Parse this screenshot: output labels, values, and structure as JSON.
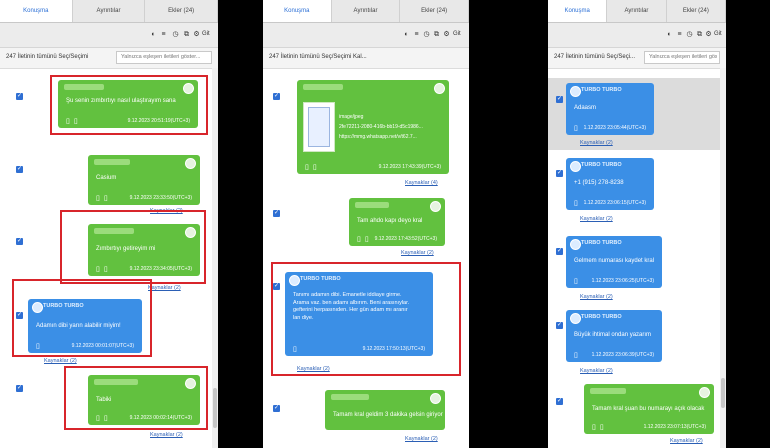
{
  "tabs": [
    "Konuşma",
    "Ayrıntılar",
    "Ekler (24)"
  ],
  "toolbar": {
    "goto_label": "Git"
  },
  "selection": {
    "label1": "247 İletinin tümünü Seç/Seçimi",
    "label2": "247 İletinin tümünü Seç/Seçimi Kal...",
    "label3": "247 İletinin tümünü Seç/Seçi...",
    "search_placeholder1": "Yalnızca eşleşen iletileri göster...",
    "search_placeholder3": "Yalnızca eşleşen iletileri göster..."
  },
  "panel1": {
    "m1_text": "Şu senin zımbırtıyı nasıl ulaştırayım sana",
    "m1_time": "9.12.2023 20:51:19(UTC+3)",
    "m2_text": "Casium",
    "m2_time": "9.12.2023 23:33:50(UTC+3)",
    "m2_src": "Kaynaklar (2)",
    "m3_text": "Zımbırtıyı getireyim mi",
    "m3_time": "9.12.2023 23:34:05(UTC+3)",
    "m3_src": "Kaynaklar (2)",
    "m4_sender": "TURBO TURBO",
    "m4_text": "Adamın dibi yarın alabilir miyim!",
    "m4_time": "9.12.2023 00:01:07(UTC+3)",
    "m4_src": "Kaynaklar (2)",
    "m5_text": "Tabiki",
    "m5_time": "9.12.2023 00:02:14(UTC+3)",
    "m5_src": "Kaynaklar (2)"
  },
  "panel2": {
    "m1_file": "image/jpeg",
    "m1_id": "2fe72211-2080-416b-bb19-d5c1986...",
    "m1_url": "https://mmg.whatsapp.net/v/t62.7...",
    "m1_time": "9.12.2023 17:43:39(UTC+3)",
    "m1_src": "Kaynaklar (4)",
    "m2_text": "Tam ahdo kapı deyo kral",
    "m2_time": "9.12.2023 17:43:52(UTC+3)",
    "m2_src": "Kaynaklar (2)",
    "m3_sender": "TURBO TURBO",
    "m3_lines": [
      "Tanımı adamın dibi. Emanetle iddiaye girme.",
      "Arama vaz. ben adamı albırım. Beni arasınıylar.",
      "gefterini herpasınıden. Her gün adam mı aranır",
      "lan diye."
    ],
    "m3_time": "9.12.2023 17:50:13(UTC+3)",
    "m3_src": "Kaynaklar (2)",
    "m4_text": "Tamam kral geldim 3 dakika gelsin giriyor",
    "m4_src": "Kaynaklar (2)"
  },
  "panel3": {
    "m1_sender": "TURBO TURBO",
    "m1_text": "Adaasm",
    "m1_time": "1.12.2023 23:05:44(UTC+3)",
    "m1_src": "Kaynaklar (2)",
    "m2_sender": "TURBO TURBO",
    "m2_text": "+1 (915) 278-8238",
    "m2_time": "1.12.2023 23:06:15(UTC+3)",
    "m2_src": "Kaynaklar (2)",
    "m3_sender": "TURBO TURBO",
    "m3_text": "Gelmem numarası kaydet kral",
    "m3_time": "1.12.2023 23:06:25(UTC+3)",
    "m3_src": "Kaynaklar (2)",
    "m4_sender": "TURBO TURBO",
    "m4_text": "Büyük ihtimal ondan yazarım",
    "m4_time": "1.12.2023 23:06:39(UTC+3)",
    "m4_src": "Kaynaklar (2)",
    "m5_text": "Tamam kral şuan bu numarayı açık olacak",
    "m5_time": "1.12.2023 23:07:13(UTC+3)",
    "m5_src": "Kaynaklar (2)"
  },
  "colors": {
    "green_bubble": "#62c13f",
    "blue_bubble": "#3b8fe6",
    "highlight": "#d8252b",
    "checkbox": "#2f6fd3"
  }
}
